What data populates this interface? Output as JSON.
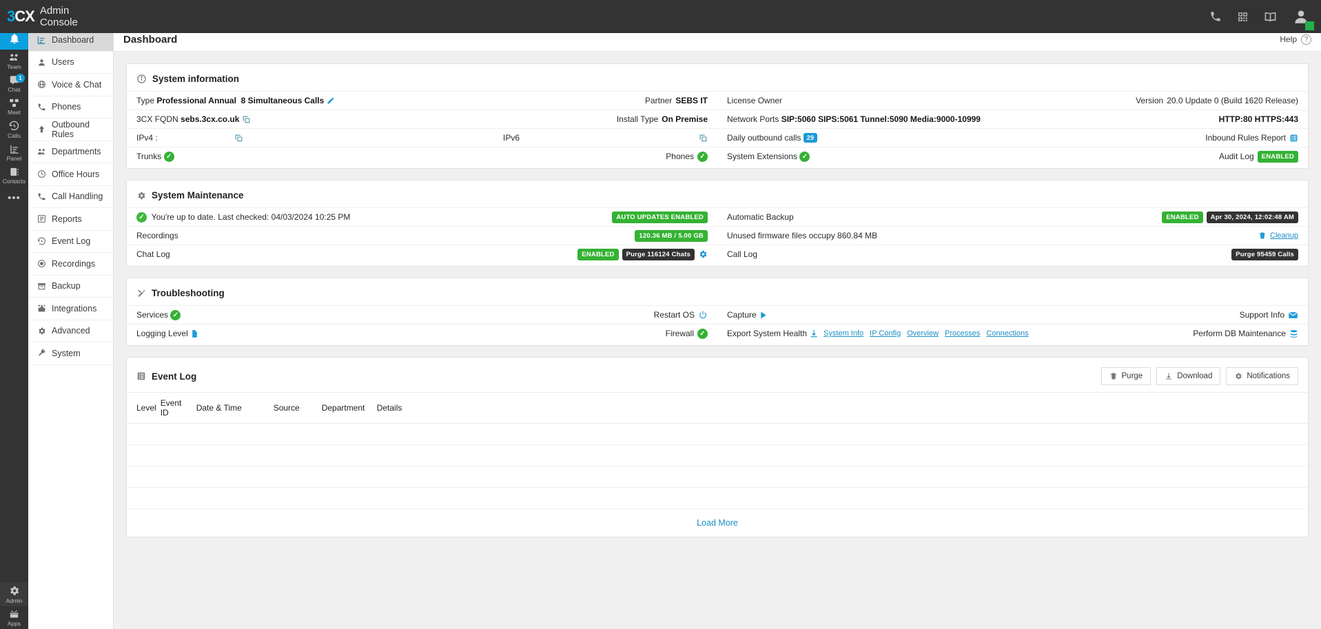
{
  "topbar": {
    "logo_3": "3",
    "logo_cx": "CX",
    "app_title": "Admin Console",
    "icons": [
      "phone-icon",
      "qrcode-icon",
      "book-icon",
      "user-avatar-icon"
    ]
  },
  "rail": {
    "items": [
      {
        "label": "",
        "icon": "bell-icon",
        "active": true,
        "badge": ""
      },
      {
        "label": "Team",
        "icon": "team-icon",
        "active": false,
        "badge": ""
      },
      {
        "label": "Chat",
        "icon": "chat-icon",
        "active": false,
        "badge": "1"
      },
      {
        "label": "Meet",
        "icon": "meet-icon",
        "active": false,
        "badge": ""
      },
      {
        "label": "Calls",
        "icon": "calls-history-icon",
        "active": false,
        "badge": ""
      },
      {
        "label": "Panel",
        "icon": "panel-icon",
        "active": false,
        "badge": ""
      },
      {
        "label": "Contacts",
        "icon": "contacts-icon",
        "active": false,
        "badge": ""
      },
      {
        "label": "",
        "icon": "more-dots-icon",
        "active": false,
        "badge": ""
      }
    ],
    "bottom": [
      {
        "label": "Admin",
        "icon": "gear-icon"
      },
      {
        "label": "Apps",
        "icon": "apps-icon"
      }
    ]
  },
  "sidebar": {
    "items": [
      {
        "label": "Dashboard",
        "icon": "dashboard-icon",
        "active": true
      },
      {
        "label": "Users",
        "icon": "user-icon",
        "active": false
      },
      {
        "label": "Voice & Chat",
        "icon": "globe-icon",
        "active": false
      },
      {
        "label": "Phones",
        "icon": "phone-device-icon",
        "active": false
      },
      {
        "label": "Outbound Rules",
        "icon": "arrow-up-icon",
        "active": false
      },
      {
        "label": "Departments",
        "icon": "departments-icon",
        "active": false
      },
      {
        "label": "Office Hours",
        "icon": "clock-icon",
        "active": false
      },
      {
        "label": "Call Handling",
        "icon": "handset-icon",
        "active": false
      },
      {
        "label": "Reports",
        "icon": "reports-icon",
        "active": false
      },
      {
        "label": "Event Log",
        "icon": "history-icon",
        "active": false
      },
      {
        "label": "Recordings",
        "icon": "record-icon",
        "active": false
      },
      {
        "label": "Backup",
        "icon": "archive-icon",
        "active": false
      },
      {
        "label": "Integrations",
        "icon": "puzzle-icon",
        "active": false
      },
      {
        "label": "Advanced",
        "icon": "gear-icon",
        "active": false
      },
      {
        "label": "System",
        "icon": "wrench-icon",
        "active": false
      }
    ]
  },
  "page": {
    "title": "Dashboard",
    "help_label": "Help"
  },
  "system_information": {
    "title": "System information",
    "rows": {
      "type_label": "Type",
      "type_value": "Professional Annual",
      "simultaneous_calls": "8 Simultaneous Calls",
      "partner_label": "Partner",
      "partner_value": "SEBS IT",
      "license_owner_label": "License Owner",
      "license_owner_value": "",
      "version_label": "Version",
      "version_value": "20.0 Update 0 (Build 1620 Release)",
      "fqdn_label": "3CX FQDN",
      "fqdn_value": "sebs.3cx.co.uk",
      "install_type_label": "Install Type",
      "install_type_value": "On Premise",
      "network_ports_label": "Network Ports",
      "network_ports_value": "SIP:5060 SIPS:5061 Tunnel:5090 Media:9000-10999",
      "http_label": "HTTP:80 HTTPS:443",
      "ipv4_label": "IPv4 :",
      "ipv4_value": "",
      "ipv6_label": "IPv6",
      "ipv6_value": "",
      "daily_outbound_label": "Daily outbound calls",
      "daily_outbound_count": "29",
      "inbound_rules_label": "Inbound Rules Report",
      "trunks_label": "Trunks",
      "phones_label": "Phones",
      "system_extensions_label": "System Extensions",
      "audit_log_label": "Audit Log",
      "audit_log_badge": "ENABLED"
    }
  },
  "system_maintenance": {
    "title": "System Maintenance",
    "update_status": "You're up to date. Last checked: 04/03/2024 10:25 PM",
    "auto_updates_badge": "AUTO UPDATES ENABLED",
    "automatic_backup_label": "Automatic Backup",
    "automatic_backup_badge": "ENABLED",
    "automatic_backup_date": "Apr 30, 2024, 12:02:48 AM",
    "recordings_label": "Recordings",
    "recordings_badge": "120.36 MB / 5.00 GB",
    "firmware_label": "Unused firmware files occupy 860.84 MB",
    "cleanup_label": "Cleanup",
    "chat_log_label": "Chat Log",
    "chat_log_badge": "ENABLED",
    "chat_log_purge": "Purge 116124 Chats",
    "call_log_label": "Call Log",
    "call_log_purge": "Purge 95459 Calls"
  },
  "troubleshooting": {
    "title": "Troubleshooting",
    "services_label": "Services",
    "restart_os_label": "Restart OS",
    "capture_label": "Capture",
    "support_info_label": "Support Info",
    "logging_level_label": "Logging Level",
    "firewall_label": "Firewall",
    "export_system_health_label": "Export System Health",
    "export_links": [
      "System Info",
      "IP Config",
      "Overview",
      "Processes",
      "Connections"
    ],
    "perform_db_label": "Perform DB Maintenance"
  },
  "event_log": {
    "title": "Event Log",
    "buttons": [
      {
        "label": "Purge",
        "icon": "trash-icon"
      },
      {
        "label": "Download",
        "icon": "download-icon"
      },
      {
        "label": "Notifications",
        "icon": "gear-icon"
      }
    ],
    "columns": [
      "Level",
      "Event ID",
      "Date & Time",
      "Source",
      "Department",
      "Details"
    ],
    "rows": [],
    "load_more_label": "Load More"
  },
  "colors": {
    "brand_blue": "#0aa0e0",
    "green": "#34b233",
    "dark": "#333333",
    "link": "#1b8fc4"
  }
}
